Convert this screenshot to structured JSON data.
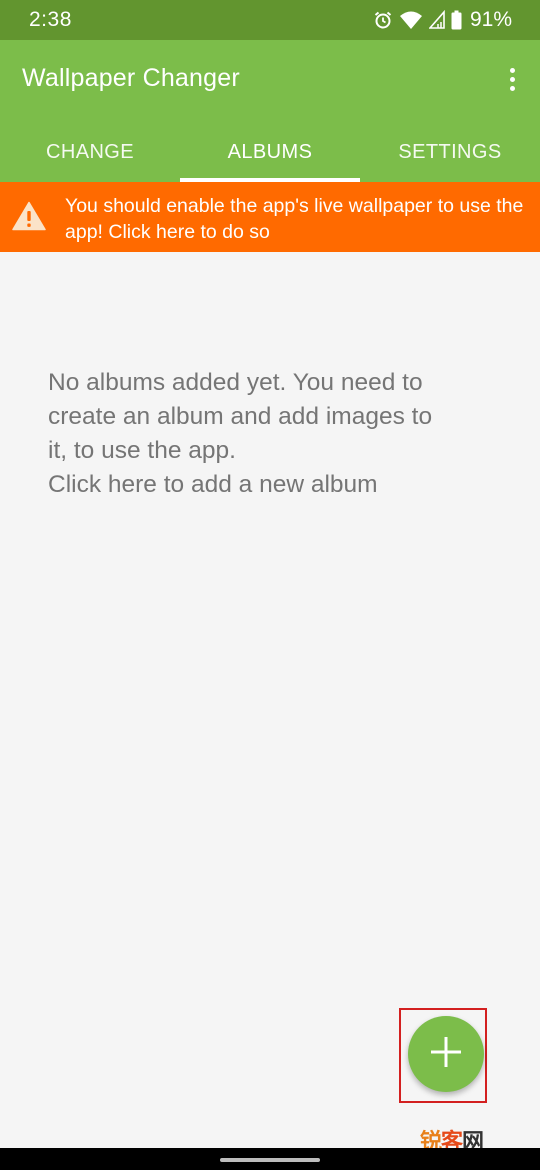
{
  "status_bar": {
    "time": "2:38",
    "battery": "91%",
    "icons": [
      "alarm-icon",
      "wifi-icon",
      "signal-icon",
      "battery-icon"
    ]
  },
  "app_bar": {
    "title": "Wallpaper Changer",
    "menu_icon": "more-vert-icon"
  },
  "tabs": [
    {
      "label": "CHANGE",
      "selected": false
    },
    {
      "label": "ALBUMS",
      "selected": true
    },
    {
      "label": "SETTINGS",
      "selected": false
    }
  ],
  "warning": {
    "icon": "warning-icon",
    "text": "You should enable the app's live wallpaper to use the app! Click here to do so"
  },
  "empty_state": {
    "line1": "No albums added yet. You need to",
    "line2": "create an album and add images to",
    "line3": "it, to use the app.",
    "line4": "Click here to add a new album"
  },
  "fab": {
    "icon": "plus-icon"
  },
  "watermark": {
    "part1": "锐",
    "part2": "客",
    "part3": "网"
  },
  "colors": {
    "status_bar": "#62952f",
    "app_bar": "#7cbd4a",
    "warning": "#ff6a00",
    "background": "#f5f5f5",
    "empty_text": "#757575",
    "fab": "#7cbd4a",
    "highlight": "#d32020"
  }
}
